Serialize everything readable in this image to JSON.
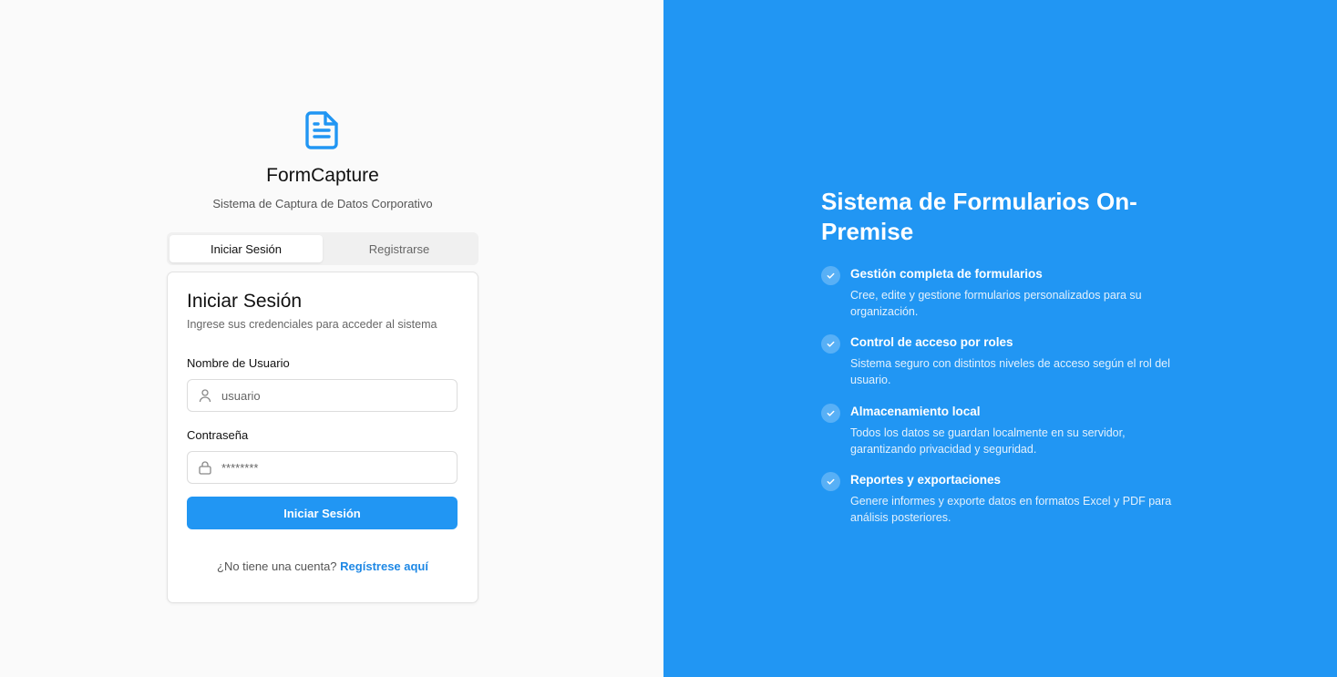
{
  "brand": {
    "name": "FormCapture",
    "tagline": "Sistema de Captura de Datos Corporativo",
    "icon": "file-text-icon",
    "accent_color": "#2196f3"
  },
  "tabs": [
    {
      "label": "Iniciar Sesión",
      "active": true
    },
    {
      "label": "Registrarse",
      "active": false
    }
  ],
  "login": {
    "title": "Iniciar Sesión",
    "subtitle": "Ingrese sus credenciales para acceder al sistema",
    "username": {
      "label": "Nombre de Usuario",
      "placeholder": "usuario",
      "value": "",
      "icon": "user-icon"
    },
    "password": {
      "label": "Contraseña",
      "placeholder": "********",
      "value": "",
      "icon": "lock-icon"
    },
    "submit_label": "Iniciar Sesión",
    "signup_prompt": "¿No tiene una cuenta?",
    "signup_link": "Regístrese aquí"
  },
  "promo": {
    "title": "Sistema de Formularios On-Premise",
    "features": [
      {
        "title": "Gestión completa de formularios",
        "description": "Cree, edite y gestione formularios personalizados para su organización.",
        "icon": "check-icon"
      },
      {
        "title": "Control de acceso por roles",
        "description": "Sistema seguro con distintos niveles de acceso según el rol del usuario.",
        "icon": "check-icon"
      },
      {
        "title": "Almacenamiento local",
        "description": "Todos los datos se guardan localmente en su servidor, garantizando privacidad y seguridad.",
        "icon": "check-icon"
      },
      {
        "title": "Reportes y exportaciones",
        "description": "Genere informes y exporte datos en formatos Excel y PDF para análisis posteriores.",
        "icon": "check-icon"
      }
    ]
  }
}
